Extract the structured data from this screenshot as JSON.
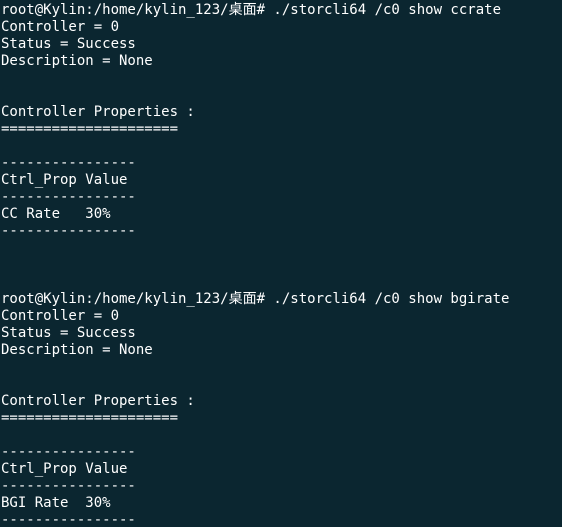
{
  "terminal": {
    "background": "#0b2630",
    "foreground": "#ffffff",
    "lines": [
      "root@Kylin:/home/kylin_123/桌面# ./storcli64 /c0 show ccrate",
      "Controller = 0",
      "Status = Success",
      "Description = None",
      "",
      "",
      "Controller Properties :",
      "=====================",
      "",
      "----------------",
      "Ctrl_Prop Value",
      "----------------",
      "CC Rate   30%",
      "----------------",
      "",
      "",
      "",
      "root@Kylin:/home/kylin_123/桌面# ./storcli64 /c0 show bgirate",
      "Controller = 0",
      "Status = Success",
      "Description = None",
      "",
      "",
      "Controller Properties :",
      "=====================",
      "",
      "----------------",
      "Ctrl_Prop Value",
      "----------------",
      "BGI Rate  30%",
      "----------------"
    ]
  }
}
